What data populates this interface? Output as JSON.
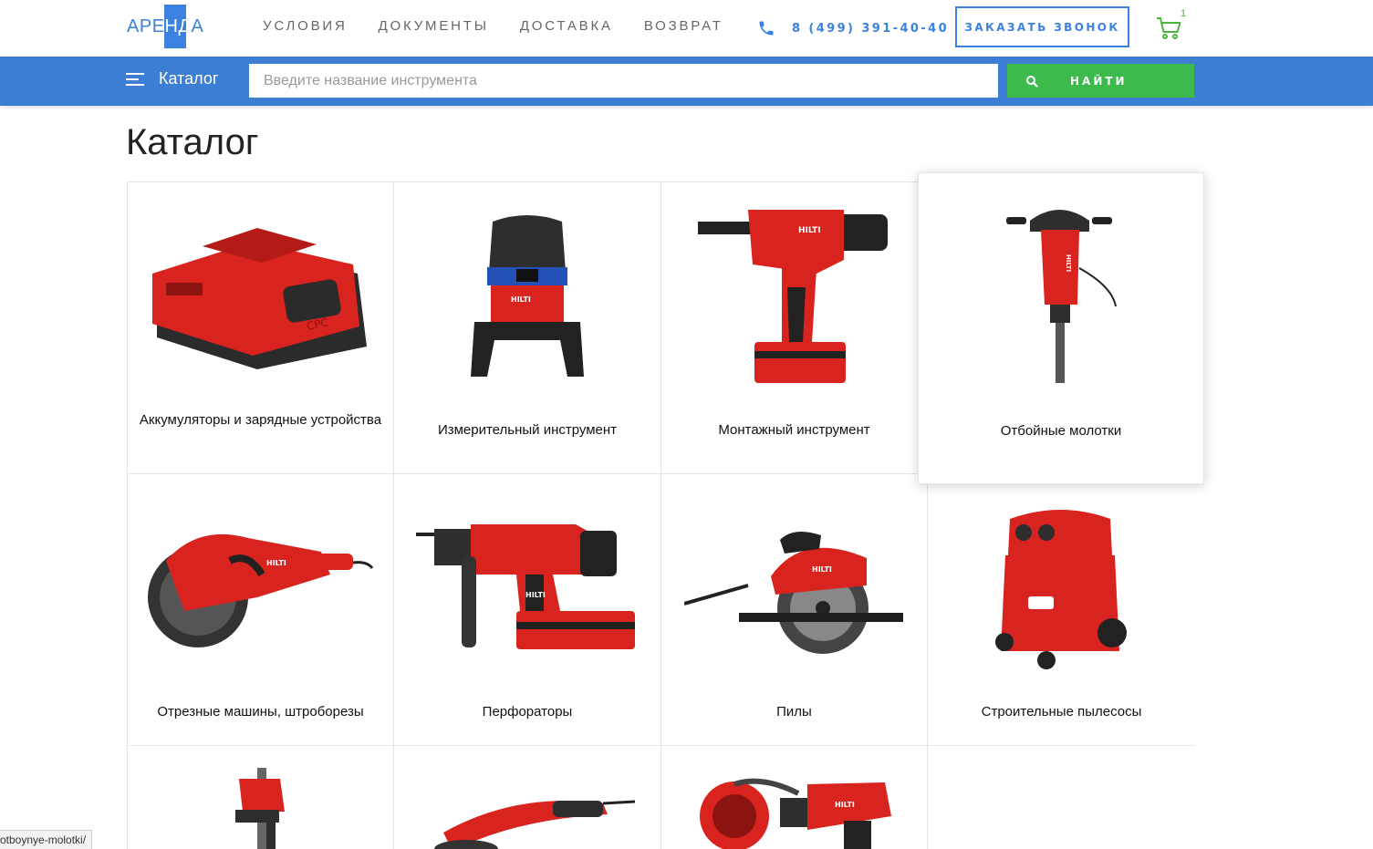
{
  "header": {
    "logo": "АРЕНДА",
    "nav": [
      "УСЛОВИЯ",
      "ДОКУМЕНТЫ",
      "ДОСТАВКА",
      "ВОЗВРАТ"
    ],
    "phone": "8 (499) 391-40-40",
    "callback_label": "ЗАКАЗАТЬ ЗВОНОК",
    "cart_count": "1"
  },
  "searchbar": {
    "catalog_label": "Каталог",
    "placeholder": "Введите название инструмента",
    "find_label": "НАЙТИ"
  },
  "page_title": "Каталог",
  "categories": [
    "Аккумуляторы и зарядные устройства",
    "Измерительный инструмент",
    "Монтажный инструмент",
    "Отбойные молотки",
    "Отрезные машины, штроборезы",
    "Перфораторы",
    "Пилы",
    "Строительные пылесосы"
  ],
  "status_url": "otboynye-molotki/",
  "colors": {
    "accent": "#3b7ed4",
    "green": "#3cba4c",
    "tool_red": "#d8231f"
  }
}
